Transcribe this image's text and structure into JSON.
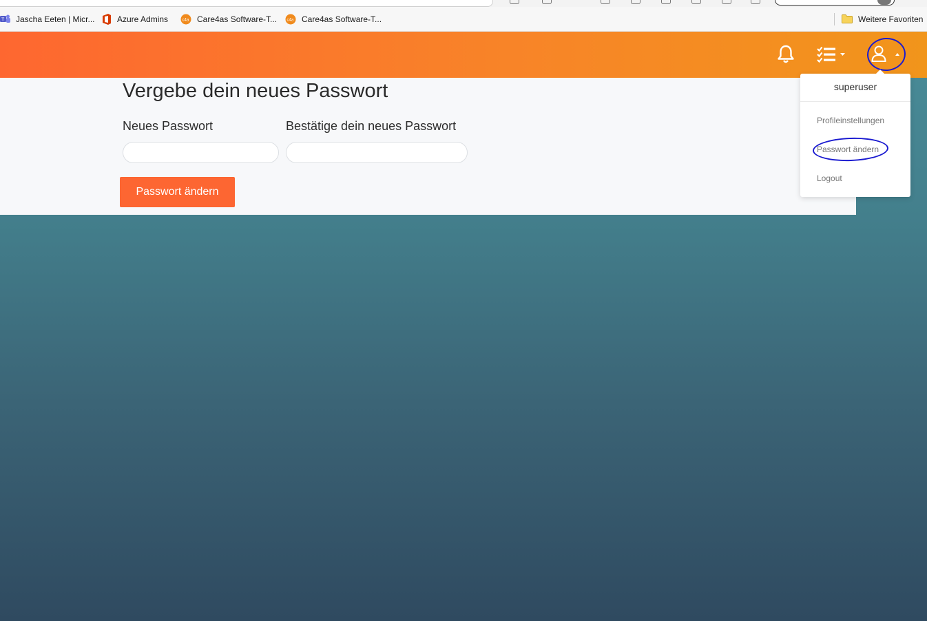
{
  "bookmarks": [
    {
      "label": "Jascha Eeten | Micr...",
      "icon": "teams-icon"
    },
    {
      "label": "Azure Admins",
      "icon": "office-icon"
    },
    {
      "label": "Care4as Software-T...",
      "icon": "care4as-icon"
    },
    {
      "label": "Care4as Software-T...",
      "icon": "care4as-icon"
    }
  ],
  "favorites_folder": {
    "label": "Weitere Favoriten",
    "icon": "folder-icon"
  },
  "header": {
    "icons": [
      "bell-icon",
      "tasks-list-icon",
      "user-icon"
    ],
    "gradient": [
      "#fe6730",
      "#f1951b"
    ]
  },
  "form": {
    "title": "Vergebe dein neues Passwort",
    "new_password_label": "Neues Passwort",
    "confirm_password_label": "Bestätige dein neues Passwort",
    "new_password_value": "",
    "confirm_password_value": "",
    "submit_label": "Passwort ändern"
  },
  "user_menu": {
    "username": "superuser",
    "items": [
      "Profileinstellungen",
      "Passwort ändern",
      "Logout"
    ]
  },
  "colors": {
    "accent": "#fd6632",
    "annotation": "#1a1ad0"
  }
}
